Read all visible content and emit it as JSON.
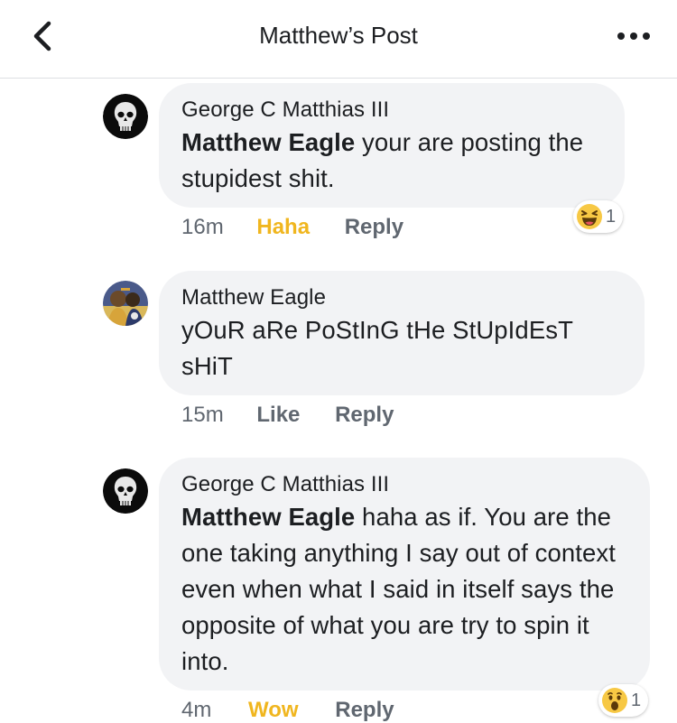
{
  "header": {
    "title": "Matthew’s Post",
    "back_icon": "chevron-left-icon",
    "more_icon": "more-horizontal-icon"
  },
  "colors": {
    "haha": "#f0b61f",
    "wow": "#f0b61f",
    "meta_gray": "#606770",
    "bubble": "#f2f3f5"
  },
  "comments": [
    {
      "author": "George C Matthias III",
      "mention": "Matthew Eagle",
      "text": " your are posting the stupidest shit.",
      "time": "16m",
      "reaction_label": "Haha",
      "reply_label": "Reply",
      "reaction_icon": "haha-emoji-icon",
      "reaction_count": "1"
    },
    {
      "author": "Matthew Eagle",
      "text": "yOuR aRe PoStInG tHe StUpIdEsT sHiT",
      "time": "15m",
      "like_label": "Like",
      "reply_label": "Reply"
    },
    {
      "author": "George C Matthias III",
      "mention": "Matthew Eagle",
      "text": " haha as if. You are the one taking anything I say out of context even when what I said in itself says the opposite of what you are try to spin it into.",
      "time": "4m",
      "reaction_label": "Wow",
      "reply_label": "Reply",
      "reaction_icon": "wow-emoji-icon",
      "reaction_count": "1"
    }
  ]
}
